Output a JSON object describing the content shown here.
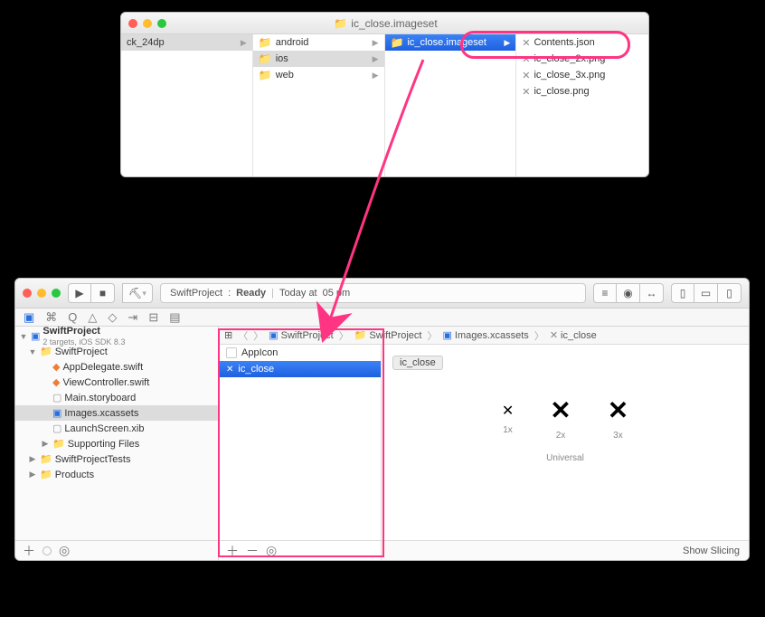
{
  "finder": {
    "title": "ic_close.imageset",
    "col0": {
      "item": "ck_24dp"
    },
    "col1": {
      "items": [
        {
          "name": "android"
        },
        {
          "name": "ios"
        },
        {
          "name": "web"
        }
      ]
    },
    "col2": {
      "item": "ic_close.imageset"
    },
    "col3": {
      "items": [
        {
          "name": "Contents.json"
        },
        {
          "name": "ic_close_2x.png"
        },
        {
          "name": "ic_close_3x.png"
        },
        {
          "name": "ic_close.png"
        }
      ]
    }
  },
  "xcode": {
    "status": {
      "project": "SwiftProject",
      "state": "Ready",
      "time_prefix": "Today at",
      "time": "05 pm"
    },
    "navigator": {
      "project": "SwiftProject",
      "subtitle": "2 targets, iOS SDK 8.3",
      "tree": [
        {
          "name": "SwiftProject",
          "type": "folder",
          "depth": 0,
          "open": true
        },
        {
          "name": "AppDelegate.swift",
          "type": "swift",
          "depth": 1
        },
        {
          "name": "ViewController.swift",
          "type": "swift",
          "depth": 1
        },
        {
          "name": "Main.storyboard",
          "type": "storyboard",
          "depth": 1
        },
        {
          "name": "Images.xcassets",
          "type": "assets",
          "depth": 1,
          "selected": true
        },
        {
          "name": "LaunchScreen.xib",
          "type": "xib",
          "depth": 1
        },
        {
          "name": "Supporting Files",
          "type": "folder",
          "depth": 1
        },
        {
          "name": "SwiftProjectTests",
          "type": "folder",
          "depth": 0
        },
        {
          "name": "Products",
          "type": "folder",
          "depth": 0
        }
      ]
    },
    "jumpbar": [
      {
        "label": "SwiftProject",
        "icon": "blue"
      },
      {
        "label": "SwiftProject",
        "icon": "yellow"
      },
      {
        "label": "Images.xcassets",
        "icon": "blue"
      },
      {
        "label": "ic_close",
        "icon": "img"
      }
    ],
    "assets": {
      "items": [
        {
          "name": "AppIcon",
          "selected": false
        },
        {
          "name": "ic_close",
          "selected": true
        }
      ]
    },
    "canvas": {
      "name": "ic_close",
      "slots": [
        "1x",
        "2x",
        "3x"
      ],
      "universal": "Universal",
      "show_slicing": "Show Slicing"
    }
  }
}
